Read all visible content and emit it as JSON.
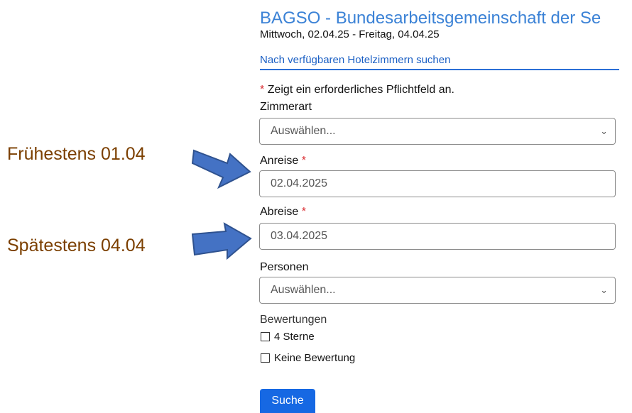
{
  "header": {
    "title": "BAGSO - Bundesarbeitsgemeinschaft der Se",
    "dates": "Mittwoch, 02.04.25 - Freitag, 04.04.25",
    "search_link": "Nach verfügbaren Hotelzimmern suchen"
  },
  "form": {
    "required_star": "*",
    "required_note": "Zeigt ein erforderliches Pflichtfeld an.",
    "room_type": {
      "label": "Zimmerart",
      "value": "Auswählen..."
    },
    "arrival": {
      "label": "Anreise",
      "value": "02.04.2025"
    },
    "departure": {
      "label": "Abreise",
      "value": "03.04.2025"
    },
    "persons": {
      "label": "Personen",
      "value": "Auswählen..."
    },
    "ratings": {
      "label": "Bewertungen",
      "options": [
        {
          "label": "4 Sterne",
          "checked": false
        },
        {
          "label": "Keine Bewertung",
          "checked": false
        }
      ]
    },
    "submit_label": "Suche"
  },
  "annotations": {
    "earliest": "Frühestens 01.04",
    "latest": "Spätestens 04.04",
    "arrow_color": "#4472c4",
    "text_color": "#7b3f00"
  },
  "colors": {
    "accent": "#1668e3",
    "title": "#3b82d6",
    "required": "#d9262c"
  }
}
